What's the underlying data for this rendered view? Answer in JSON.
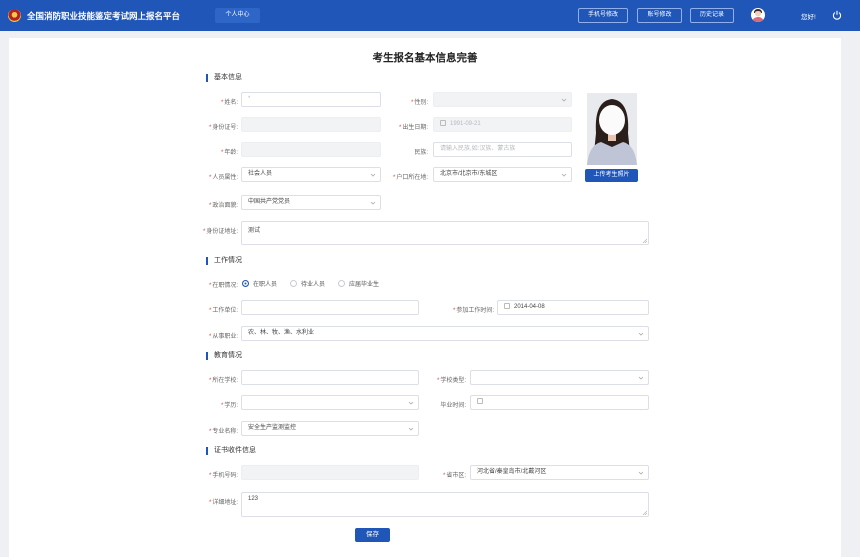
{
  "header": {
    "site_title": "全国消防职业技能鉴定考试网上报名平台",
    "personal_center": "个人中心",
    "phone_modify": "手机号修改",
    "account_modify": "账号修改",
    "history": "历史记录",
    "greeting": "您好!"
  },
  "page": {
    "title": "考生报名基本信息完善"
  },
  "basic": {
    "section": "基本信息",
    "name_label": "姓名:",
    "name_value": "*",
    "gender_label": "性别:",
    "id_label": "身份证号:",
    "birth_label": "出生日期:",
    "birth_value": "1991-09-21",
    "age_label": "年龄:",
    "ethnicity_label": "民族:",
    "ethnicity_placeholder": "请输入民族,如:汉族、蒙古族",
    "category_label": "人员属性:",
    "category_value": "社会人员",
    "hukou_label": "户口所在地:",
    "hukou_value": "北京市/北京市/东城区",
    "political_label": "政治面貌:",
    "political_value": "中国共产党党员",
    "address_label": "身份证地址:",
    "address_value": "测试",
    "upload_photo": "上传考生照片"
  },
  "work": {
    "section": "工作情况",
    "status_label": "在职情况:",
    "options": [
      "在职人员",
      "待业人员",
      "应届毕业生"
    ],
    "selected_index": 0,
    "employer_label": "工作单位:",
    "start_label": "参加工作时间:",
    "start_value": "2014-04-08",
    "occupation_label": "从事职业:",
    "occupation_value": "农、林、牧、渔、水利业"
  },
  "education": {
    "section": "教育情况",
    "school_label": "所在学校:",
    "school_type_label": "学校类型:",
    "degree_label": "学历:",
    "grad_label": "毕业时间:",
    "major_label": "专业名称:",
    "major_value": "安全生产监测监控"
  },
  "cert": {
    "section": "证书收件信息",
    "phone_label": "手机号码:",
    "region_label": "省市区:",
    "region_value": "河北省/秦皇岛市/北戴河区",
    "detail_label": "详细地址:",
    "detail_value": "123"
  },
  "actions": {
    "save": "保存"
  },
  "colors": {
    "primary": "#1f56b8",
    "required": "#e0433b"
  }
}
